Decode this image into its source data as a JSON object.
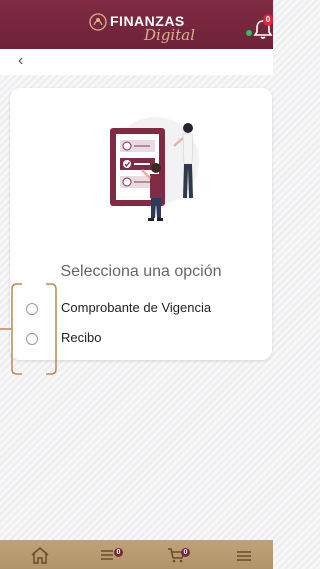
{
  "header": {
    "logo_title": "FINANZAS",
    "logo_subtitle": "Digital",
    "notification_count": "0",
    "online_status_color": "#27c25a",
    "brand_color": "#7a2a3f",
    "accent_color": "#bfa27a"
  },
  "nav": {
    "back_icon": "chevron-left-icon",
    "back_label": "‹"
  },
  "selection": {
    "prompt": "Selecciona una opción",
    "options": [
      {
        "label": "Comprobante de Vigencia",
        "selected": false
      },
      {
        "label": "Recibo",
        "selected": false
      }
    ]
  },
  "bottom_nav": {
    "items": [
      {
        "icon": "home-icon"
      },
      {
        "icon": "list-icon",
        "badge": "0"
      },
      {
        "icon": "cart-icon",
        "badge": "0"
      },
      {
        "icon": "menu-icon"
      }
    ]
  }
}
